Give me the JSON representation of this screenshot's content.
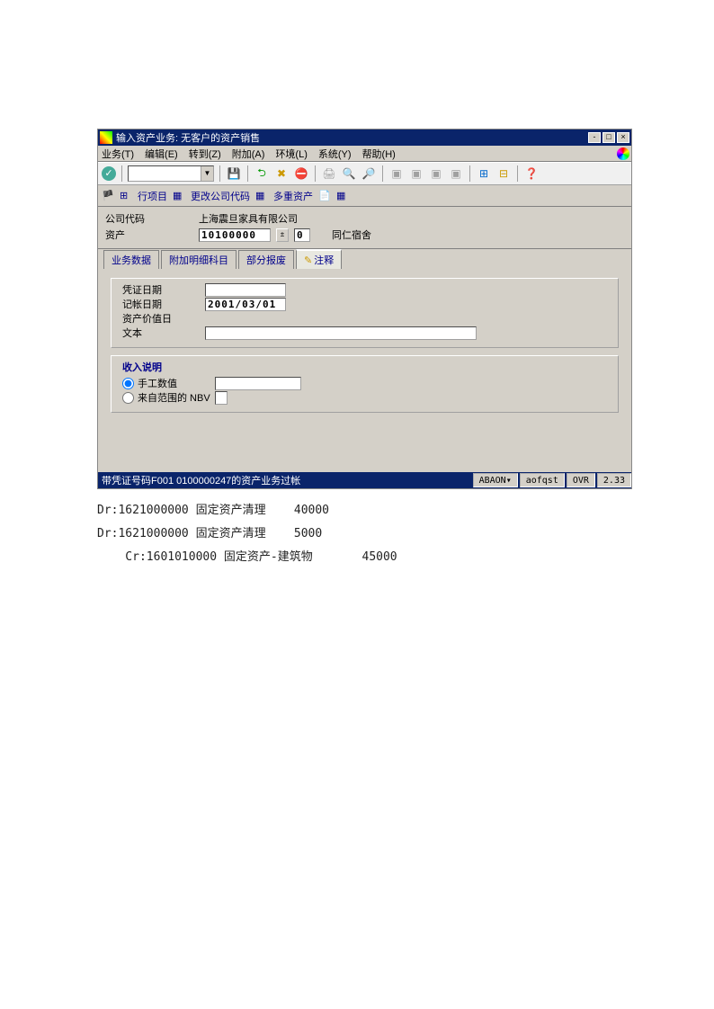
{
  "window": {
    "title": "输入资产业务: 无客户的资产销售",
    "minimize": "-",
    "restore": "□",
    "close": "×"
  },
  "menu": {
    "items": [
      "业务(T)",
      "编辑(E)",
      "转到(Z)",
      "附加(A)",
      "环境(L)",
      "系统(Y)",
      "帮助(H)"
    ]
  },
  "toolbar1": {
    "check": "✓",
    "save_icon": "💾",
    "back_icon": "⮌",
    "cancel_icon": "✖",
    "stop_icon": "⛔",
    "print_icon": "🖨",
    "find_icon": "🔍",
    "findnext_icon": "🔎",
    "nav1": "▣",
    "nav2": "▣",
    "nav3": "▣",
    "nav4": "▣",
    "layout1": "⊞",
    "layout2": "⊟",
    "help_icon": "❓"
  },
  "toolbar2": {
    "item_icon": "⊞",
    "line_items": "行项目",
    "change_company": "更改公司代码",
    "multi_assets": "多重资产",
    "doc_icon": "📄",
    "grid_icon": "▦"
  },
  "header": {
    "company_code_label": "公司代码",
    "company_name": "上海震旦家具有限公司",
    "asset_label": "资产",
    "asset_number": "10100000",
    "asset_sub": "0",
    "asset_name": "同仁宿舍"
  },
  "tabs": {
    "t1": "业务数据",
    "t2": "附加明细科目",
    "t3": "部分报废",
    "t4": "注释"
  },
  "form": {
    "doc_date_label": "凭证日期",
    "posting_date_label": "记帐日期",
    "posting_date": "2001/03/01",
    "asset_value_date_label": "资产价值日",
    "text_label": "文本",
    "income_group": "收入说明",
    "manual_value": "手工数值",
    "from_nbv": "来自范围的 NBV"
  },
  "status": {
    "message": "带凭证号码F001 0100000247的资产业务过帐",
    "tcode": "ABAON",
    "user": "aofqst",
    "mode": "OVR",
    "time": "2.33"
  },
  "journal": {
    "line1": "Dr:1621000000 固定资产清理    40000",
    "line2": "Dr:1621000000 固定资产清理    5000",
    "line3": "    Cr:1601010000 固定资产-建筑物       45000"
  }
}
